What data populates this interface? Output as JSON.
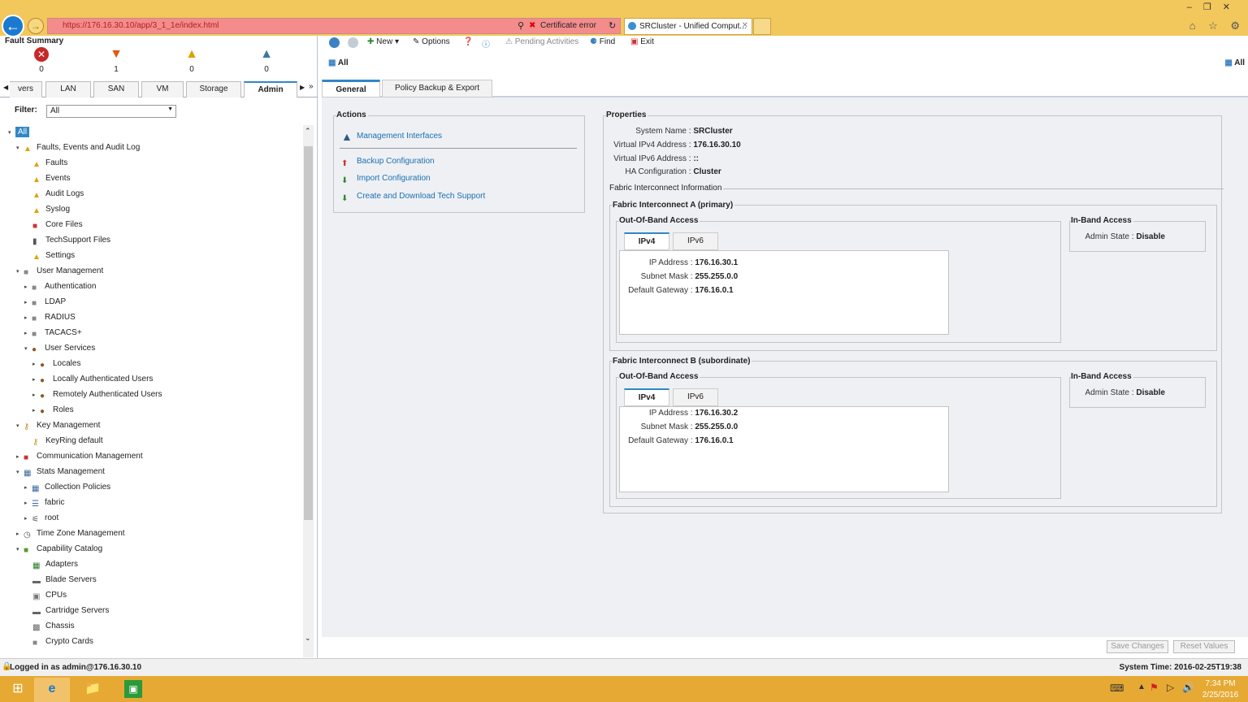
{
  "browser": {
    "url": "https://176.16.30.10/app/3_1_1e/index.html",
    "cert_error": "Certificate error",
    "tab_title": "SRCluster - Unified Comput..."
  },
  "fault_summary": {
    "title": "Fault Summary",
    "critical": "0",
    "major": "1",
    "minor": "0",
    "warning": "0"
  },
  "nav_tabs": [
    "vers",
    "LAN",
    "SAN",
    "VM",
    "Storage",
    "Admin"
  ],
  "filter": {
    "label": "Filter:",
    "value": "All"
  },
  "tree": {
    "root": "All",
    "faults": "Faults, Events and Audit Log",
    "faults_items": [
      "Faults",
      "Events",
      "Audit Logs",
      "Syslog",
      "Core Files",
      "TechSupport Files",
      "Settings"
    ],
    "user_mgmt": "User Management",
    "user_items": [
      "Authentication",
      "LDAP",
      "RADIUS",
      "TACACS+"
    ],
    "user_services": "User Services",
    "user_services_items": [
      "Locales",
      "Locally Authenticated Users",
      "Remotely Authenticated Users",
      "Roles"
    ],
    "key_mgmt": "Key Management",
    "keyring": "KeyRing default",
    "comm_mgmt": "Communication Management",
    "stats_mgmt": "Stats Management",
    "stats_items": [
      "Collection Policies",
      "fabric",
      "root"
    ],
    "tz_mgmt": "Time Zone Management",
    "capability": "Capability Catalog",
    "capability_items": [
      "Adapters",
      "Blade Servers",
      "CPUs",
      "Cartridge Servers",
      "Chassis",
      "Crypto Cards"
    ]
  },
  "toolbar": {
    "new": "New",
    "options": "Options",
    "pending": "Pending Activities",
    "find": "Find",
    "exit": "Exit"
  },
  "breadcrumb": "All",
  "breadcrumb_right": "All",
  "content_tabs": [
    "General",
    "Policy Backup & Export"
  ],
  "actions": {
    "title": "Actions",
    "items": [
      "Management Interfaces",
      "Backup Configuration",
      "Import Configuration",
      "Create and Download Tech Support"
    ]
  },
  "properties": {
    "title": "Properties",
    "system_name_label": "System Name",
    "system_name": "SRCluster",
    "vipv4_label": "Virtual IPv4 Address",
    "vipv4": "176.16.30.10",
    "vipv6_label": "Virtual IPv6 Address",
    "vipv6": "::",
    "ha_label": "HA Configuration",
    "ha": "Cluster",
    "fi_info": "Fabric Interconnect Information"
  },
  "fi_a": {
    "title": "Fabric Interconnect A (primary)",
    "oob": "Out-Of-Band Access",
    "tabs": [
      "IPv4",
      "IPv6"
    ],
    "ip_label": "IP Address",
    "ip": "176.16.30.1",
    "mask_label": "Subnet Mask",
    "mask": "255.255.0.0",
    "gw_label": "Default Gateway",
    "gw": "176.16.0.1",
    "inband": "In-Band Access",
    "admin_label": "Admin State",
    "admin": "Disable"
  },
  "fi_b": {
    "title": "Fabric Interconnect B (subordinate)",
    "oob": "Out-Of-Band Access",
    "tabs": [
      "IPv4",
      "IPv6"
    ],
    "ip_label": "IP Address",
    "ip": "176.16.30.2",
    "mask_label": "Subnet Mask",
    "mask": "255.255.0.0",
    "gw_label": "Default Gateway",
    "gw": "176.16.0.1",
    "inband": "In-Band Access",
    "admin_label": "Admin State",
    "admin": "Disable"
  },
  "buttons": {
    "save": "Save Changes",
    "reset": "Reset Values"
  },
  "status": {
    "logged_in": "Logged in as admin@176.16.30.10",
    "system_time": "System Time: 2016-02-25T19:38"
  },
  "taskbar": {
    "time": "7:34 PM",
    "date": "2/25/2016"
  },
  "colors": {
    "accent": "#2f87c8",
    "taskbar": "#e6a933",
    "chrome": "#f2c75c",
    "address_error": "#f48c8c"
  }
}
